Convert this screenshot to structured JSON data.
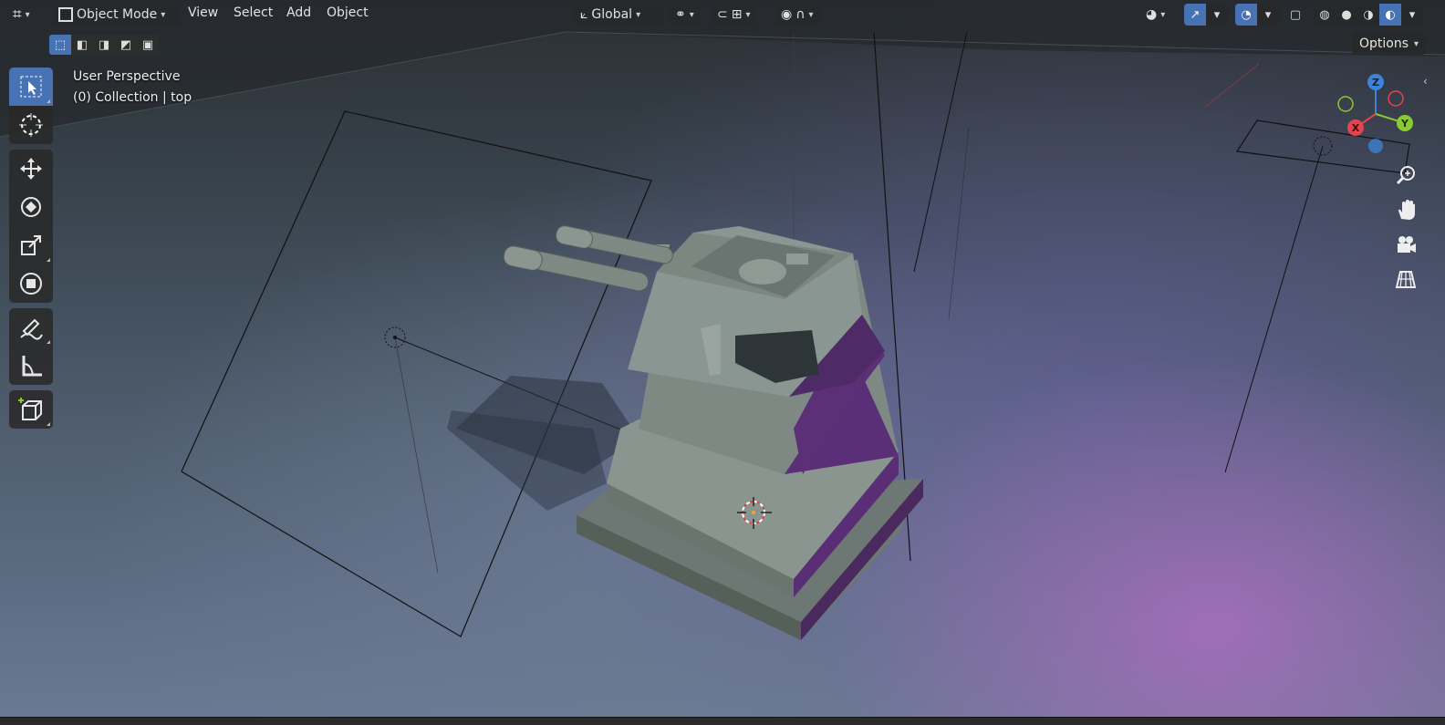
{
  "header": {
    "editor_type_icon": "axes-grid-icon",
    "mode_label": "Object Mode",
    "menus": [
      "View",
      "Select",
      "Add",
      "Object"
    ],
    "orientation_label": "Global",
    "options_label": "Options"
  },
  "overlay": {
    "perspective": "User Perspective",
    "collection": "(0) Collection | top"
  },
  "gizmo": {
    "z": "Z",
    "y": "Y",
    "x": "X",
    "colors": {
      "x": "#e5434f",
      "y": "#8bc932",
      "z": "#3d84d8"
    }
  },
  "toolbar": {
    "tools": [
      "select-box",
      "cursor",
      "move",
      "rotate",
      "scale",
      "transform",
      "annotate",
      "measure",
      "add-cube"
    ],
    "active_tool": "select-box"
  },
  "shading": {
    "active_mode": "rendered"
  },
  "colors": {
    "accent": "#4772b3",
    "model": "#7f8a85",
    "model_shadow": "#5a2e73"
  }
}
